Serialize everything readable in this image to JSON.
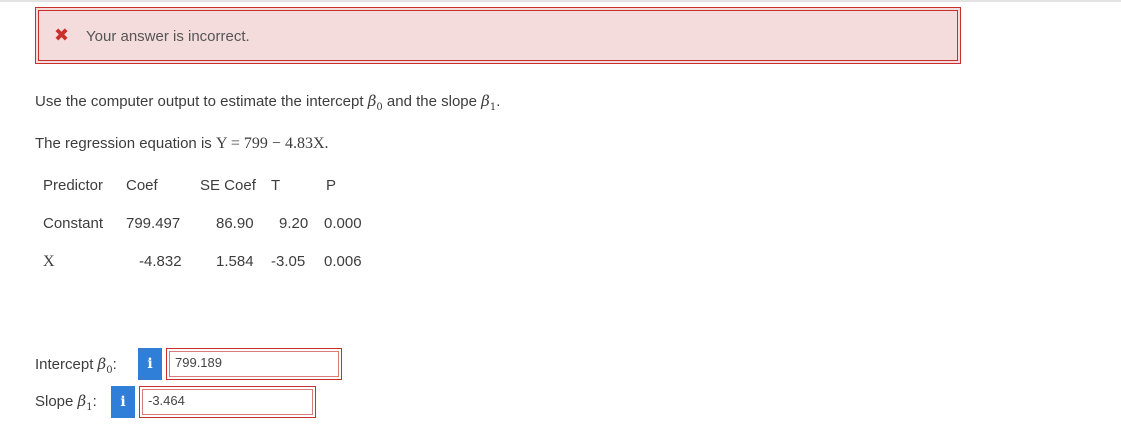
{
  "alert": {
    "icon": "close-icon",
    "text": "Your answer is incorrect.",
    "color": "#c9302c"
  },
  "question": {
    "prefix": "Use the computer output to estimate the intercept ",
    "beta0": "β",
    "beta0_sub": "0",
    "middle": " and the slope ",
    "beta1": "β",
    "beta1_sub": "1",
    "suffix": "."
  },
  "equation": {
    "prefix": "The regression equation is ",
    "formula": "Y = 799 − 4.83X."
  },
  "table": {
    "headers": [
      "Predictor",
      "Coef",
      "SE Coef",
      "T",
      "P"
    ],
    "rows": [
      [
        "Constant",
        "799.497",
        "86.90",
        "9.20",
        "0.000"
      ],
      [
        "X",
        "-4.832",
        "1.584",
        "-3.05",
        "0.006"
      ]
    ]
  },
  "answers": {
    "intercept": {
      "label": "Intercept ",
      "symbol": "β",
      "sub": "0",
      "colon": ":",
      "info": "i",
      "value": "799.189"
    },
    "slope": {
      "label": "Slope ",
      "symbol": "β",
      "sub": "1",
      "colon": ":",
      "info": "i",
      "value": "-3.464"
    }
  },
  "colors": {
    "error": "#c9302c",
    "info": "#2f7ed8",
    "alert_bg": "#f4dcdc"
  }
}
